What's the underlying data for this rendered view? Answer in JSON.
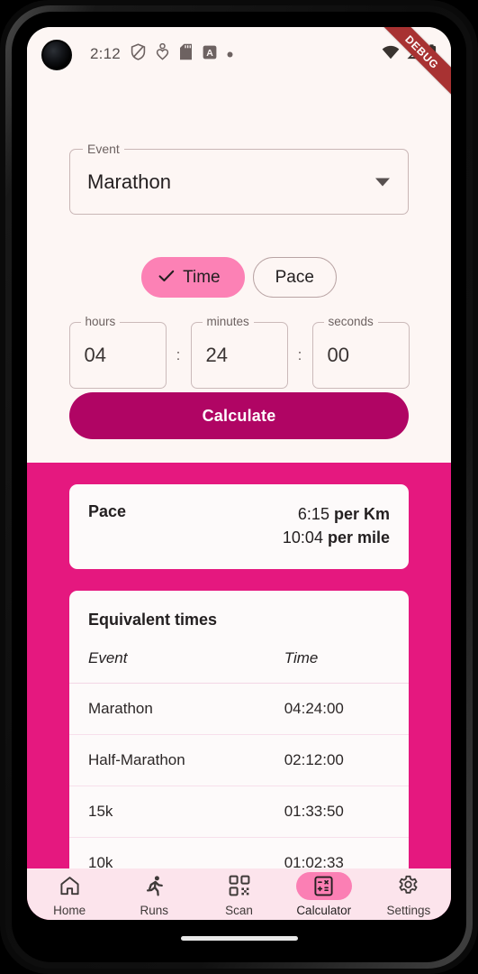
{
  "status_bar": {
    "time": "2:12",
    "icons": [
      "shield-icon",
      "person-heart-icon",
      "sd-card-icon",
      "letter-a-icon",
      "dot-icon"
    ],
    "right_icons": [
      "wifi-icon",
      "cellular-signal-icon",
      "battery-icon"
    ]
  },
  "debug_ribbon": {
    "label": "DEBUG",
    "color": "#a83232"
  },
  "event_field": {
    "legend": "Event",
    "value": "Marathon",
    "caret": "chevron-down-icon"
  },
  "mode_toggle": {
    "options": [
      {
        "label": "Time",
        "selected": true
      },
      {
        "label": "Pace",
        "selected": false
      }
    ],
    "selected_color": "#fc81b5"
  },
  "time_inputs": {
    "separator": ":",
    "fields": [
      {
        "legend": "hours",
        "value": "04"
      },
      {
        "legend": "minutes",
        "value": "24"
      },
      {
        "legend": "seconds",
        "value": "00"
      }
    ]
  },
  "calculate_button": {
    "label": "Calculate",
    "color": "#b00564"
  },
  "results": {
    "background_color": "#e5187f",
    "pace_card": {
      "label": "Pace",
      "lines": [
        {
          "value": "6:15",
          "unit": "per Km"
        },
        {
          "value": "10:04",
          "unit": "per mile"
        }
      ]
    },
    "equivalent_times": {
      "title": "Equivalent times",
      "columns": {
        "event": "Event",
        "time": "Time"
      },
      "rows": [
        {
          "event": "Marathon",
          "time": "04:24:00"
        },
        {
          "event": "Half-Marathon",
          "time": "02:12:00"
        },
        {
          "event": "15k",
          "time": "01:33:50"
        },
        {
          "event": "10k",
          "time": "01:02:33"
        }
      ]
    }
  },
  "bottom_nav": {
    "items": [
      {
        "label": "Home",
        "icon": "home-icon",
        "selected": false
      },
      {
        "label": "Runs",
        "icon": "running-icon",
        "selected": false
      },
      {
        "label": "Scan",
        "icon": "qr-code-icon",
        "selected": false
      },
      {
        "label": "Calculator",
        "icon": "calculator-icon",
        "selected": true
      },
      {
        "label": "Settings",
        "icon": "gear-icon",
        "selected": false
      }
    ],
    "selected_pill_color": "#fb7fb4"
  }
}
